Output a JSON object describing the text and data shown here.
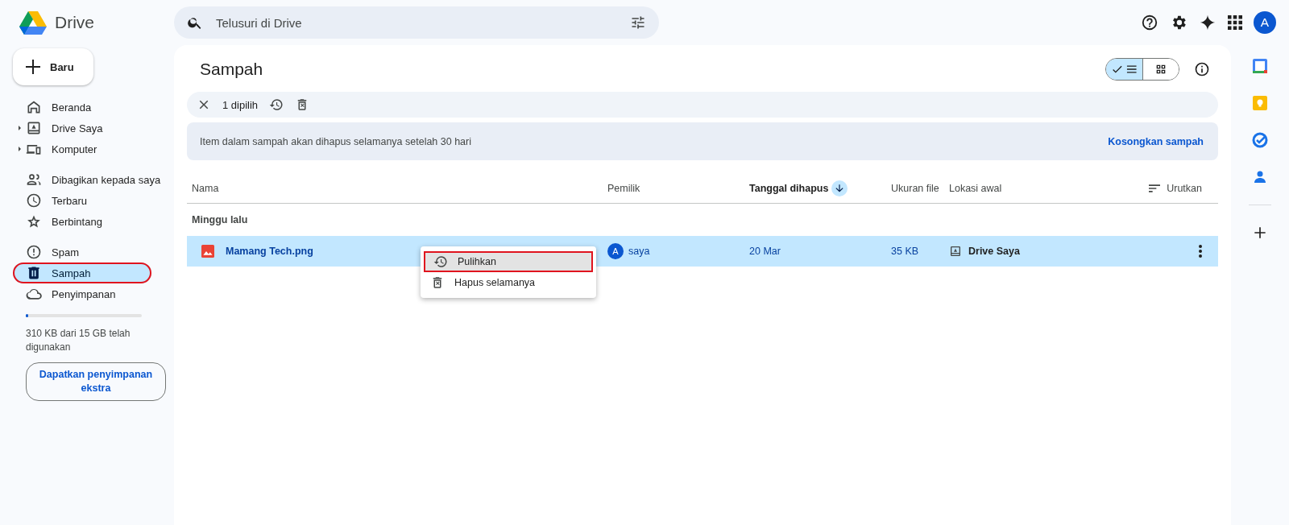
{
  "app": {
    "name": "Drive"
  },
  "search": {
    "placeholder": "Telusuri di Drive"
  },
  "account": {
    "initial": "A"
  },
  "new_button": {
    "label": "Baru"
  },
  "sidebar": {
    "groups": [
      [
        {
          "label": "Beranda",
          "selected": false,
          "expandable": false,
          "annotated": false
        },
        {
          "label": "Drive Saya",
          "selected": false,
          "expandable": true,
          "annotated": false
        },
        {
          "label": "Komputer",
          "selected": false,
          "expandable": true,
          "annotated": false
        }
      ],
      [
        {
          "label": "Dibagikan kepada saya",
          "selected": false,
          "expandable": false,
          "annotated": false
        },
        {
          "label": "Terbaru",
          "selected": false,
          "expandable": false,
          "annotated": false
        },
        {
          "label": "Berbintang",
          "selected": false,
          "expandable": false,
          "annotated": false
        }
      ],
      [
        {
          "label": "Spam",
          "selected": false,
          "expandable": false,
          "annotated": false
        },
        {
          "label": "Sampah",
          "selected": true,
          "expandable": false,
          "annotated": true
        },
        {
          "label": "Penyimpanan",
          "selected": false,
          "expandable": false,
          "annotated": false
        }
      ]
    ]
  },
  "storage": {
    "level": 0.02,
    "text": "310 KB dari 15 GB telah digunakan",
    "button": "Dapatkan penyimpanan ekstra"
  },
  "page": {
    "title": "Sampah",
    "view_buttons": [
      {
        "selected": true
      },
      {
        "selected": false
      }
    ]
  },
  "selection_bar": {
    "count": "1 dipilih"
  },
  "notice": {
    "text": "Item dalam sampah akan dihapus selamanya setelah 30 hari",
    "action": "Kosongkan sampah"
  },
  "table": {
    "columns": [
      {
        "label": "Nama",
        "sorted": false
      },
      {
        "label": "Pemilik",
        "sorted": false
      },
      {
        "label": "Tanggal dihapus",
        "sorted": true
      },
      {
        "label": "Ukuran file",
        "sorted": false
      },
      {
        "label": "Lokasi awal",
        "sorted": false
      }
    ],
    "sort_button": "Urutkan",
    "group": "Minggu lalu",
    "rows": [
      {
        "name": "Mamang Tech.png",
        "owner_initial": "A",
        "owner": "saya",
        "date": "20 Mar",
        "size": "35 KB",
        "location": "Drive Saya",
        "selected": true
      }
    ]
  },
  "context_menu": {
    "items": [
      {
        "label": "Pulihkan",
        "highlighted": true,
        "annotated": true
      },
      {
        "label": "Hapus selamanya",
        "highlighted": false,
        "annotated": false
      }
    ]
  }
}
